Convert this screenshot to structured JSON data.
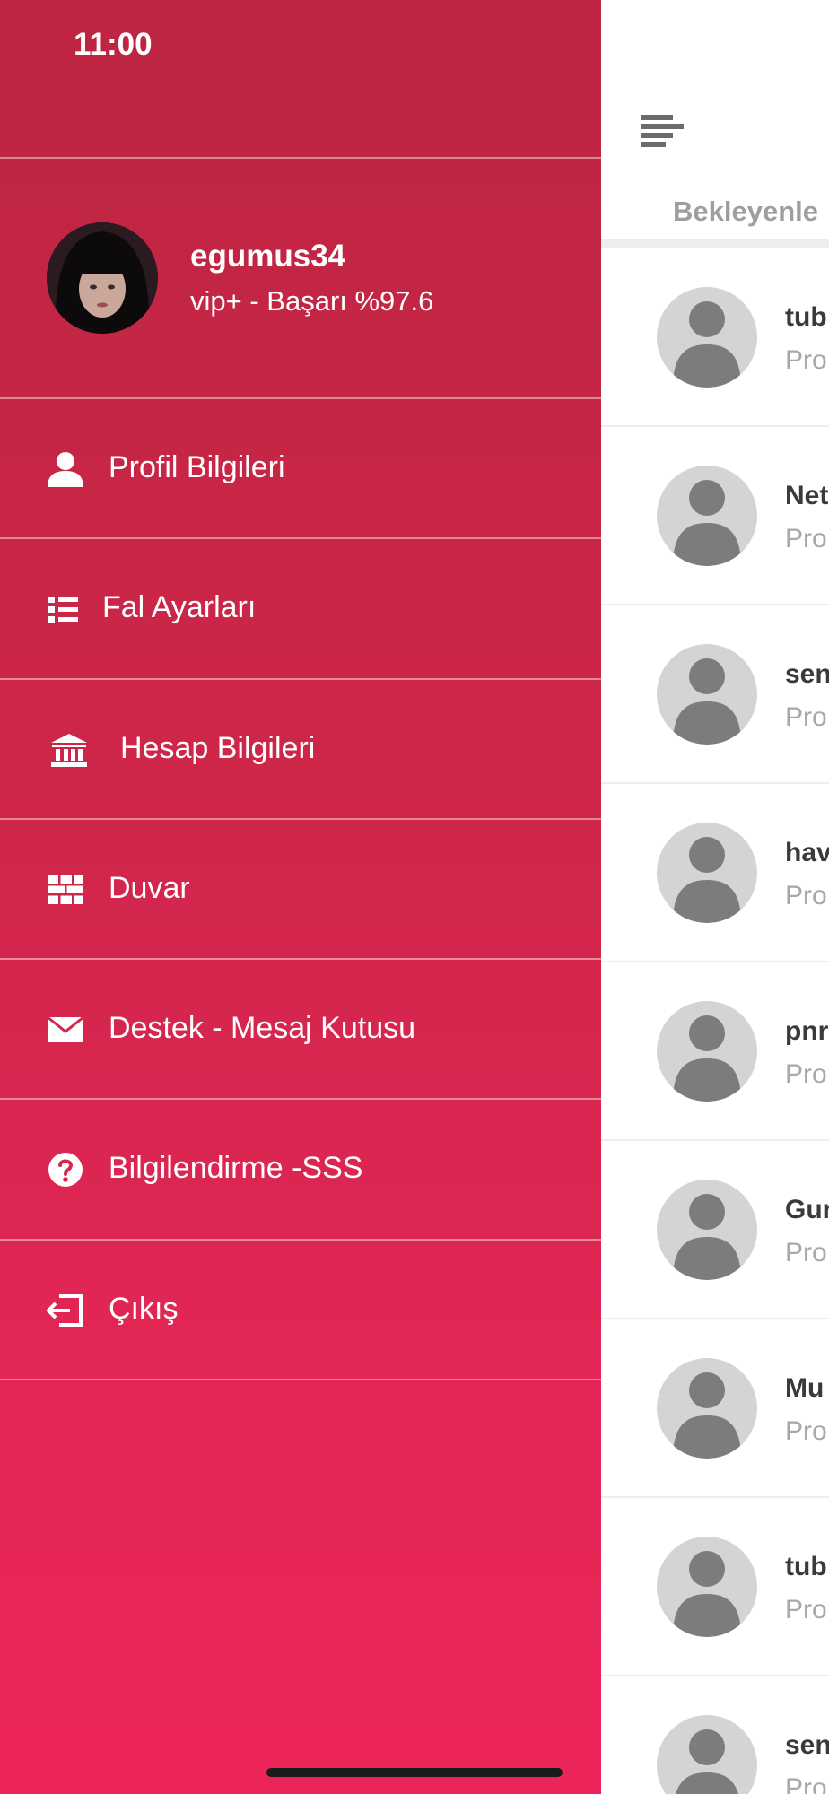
{
  "status_bar": {
    "time": "11:00"
  },
  "profile": {
    "username": "egumus34",
    "status": "vip+ - Başarı %97.6"
  },
  "menu": [
    {
      "label": "Profil Bilgileri",
      "icon": "user-icon"
    },
    {
      "label": "Fal Ayarları",
      "icon": "list-icon"
    },
    {
      "label": "Hesap Bilgileri",
      "icon": "bank-icon"
    },
    {
      "label": "Duvar",
      "icon": "wall-icon"
    },
    {
      "label": "Destek - Mesaj Kutusu",
      "icon": "envelope-icon"
    },
    {
      "label": "Bilgilendirme -SSS",
      "icon": "question-circle-icon"
    },
    {
      "label": "Çıkış",
      "icon": "sign-out-icon"
    }
  ],
  "content": {
    "tab_label": "Bekleyenle",
    "list": [
      {
        "name": "tub",
        "sub": "Pro"
      },
      {
        "name": "Net",
        "sub": "Pro"
      },
      {
        "name": "sen",
        "sub": "Pro"
      },
      {
        "name": "hav",
        "sub": "Pro"
      },
      {
        "name": "pnr",
        "sub": "Pro"
      },
      {
        "name": "Gur",
        "sub": "Pro"
      },
      {
        "name": "Mu",
        "sub": "Pro"
      },
      {
        "name": "tub",
        "sub": "Pro"
      },
      {
        "name": "sen",
        "sub": "Pro"
      }
    ]
  },
  "colors": {
    "drawer_top": "#bd2542",
    "drawer_bottom": "#ec2558",
    "avatar_placeholder_bg": "#d4d4d4",
    "avatar_placeholder_fg": "#7c7c7c"
  }
}
